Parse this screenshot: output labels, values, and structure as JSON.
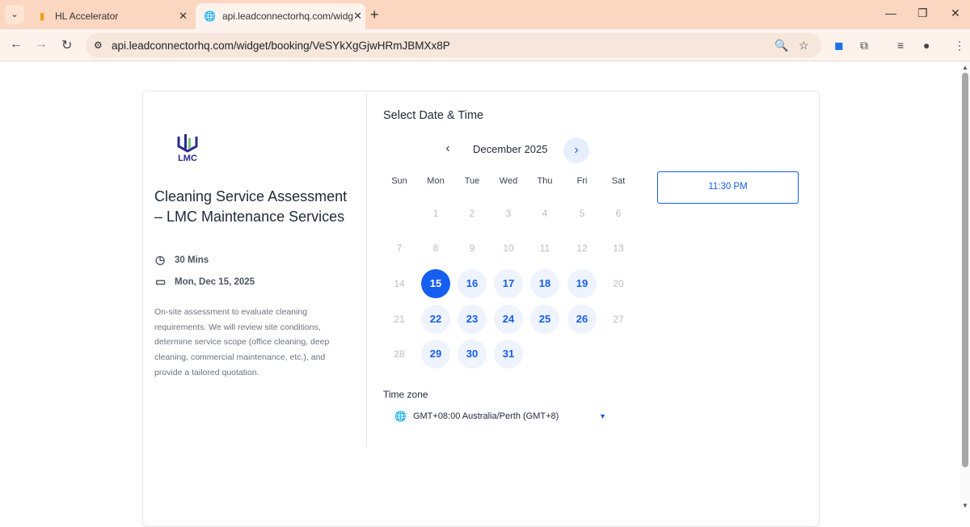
{
  "browser": {
    "tabs": [
      {
        "title": "HL Accelerator",
        "active": false
      },
      {
        "title": "api.leadconnectorhq.com/widg",
        "active": true
      }
    ],
    "url": "api.leadconnectorhq.com/widget/booking/VeSYkXgGjwHRmJBMXx8P"
  },
  "event": {
    "logo_text": "LMC",
    "title": "Cleaning Service Assessment – LMC Maintenance Services",
    "duration": "30 Mins",
    "date": "Mon, Dec 15, 2025",
    "description": "On-site assessment to evaluate cleaning requirements. We will review site conditions, determine service scope (office cleaning, deep cleaning, commercial maintenance, etc.), and provide a tailored quotation."
  },
  "calendar": {
    "heading": "Select Date & Time",
    "month": "December 2025",
    "weekdays": [
      "Sun",
      "Mon",
      "Tue",
      "Wed",
      "Thu",
      "Fri",
      "Sat"
    ],
    "first_weekday": 1,
    "days_in_month": 31,
    "available": [
      15,
      16,
      17,
      18,
      19,
      22,
      23,
      24,
      25,
      26,
      29,
      30,
      31
    ],
    "selected": 15,
    "accent": "#155eef"
  },
  "slots": [
    "11:30 PM"
  ],
  "timezone": {
    "label": "Time zone",
    "value": "GMT+08:00 Australia/Perth (GMT+8)"
  }
}
